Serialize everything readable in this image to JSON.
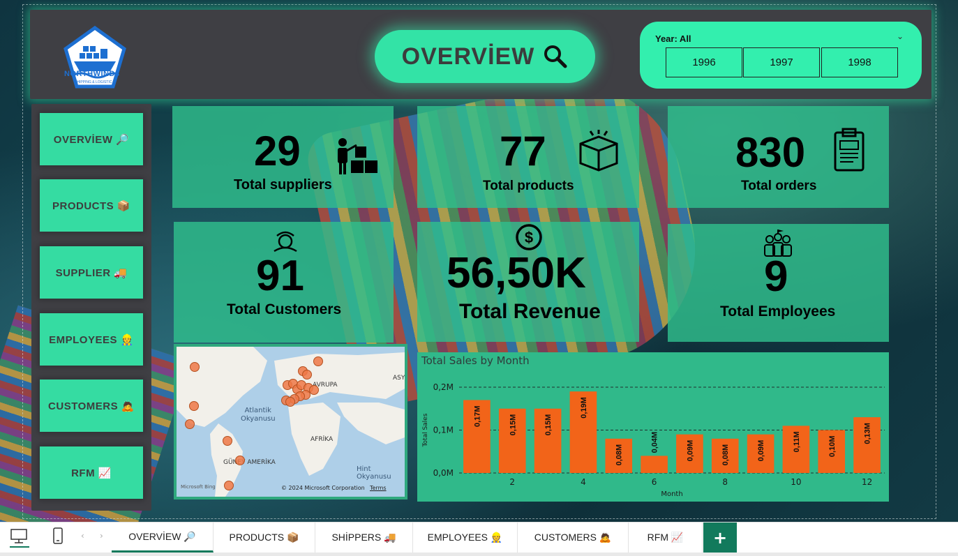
{
  "header": {
    "logo_text": "NORTHWIND",
    "logo_sub": "SHIPPING & LOGISTIC",
    "title": "OVERVİEW"
  },
  "year_filter": {
    "label": "Year: All",
    "options": [
      "1996",
      "1997",
      "1998"
    ]
  },
  "nav": {
    "items": [
      {
        "label": "OVERVİEW 🔎"
      },
      {
        "label": "PRODUCTS 📦"
      },
      {
        "label": "SUPPLIER 🚚"
      },
      {
        "label": "EMPLOYEES 👷"
      },
      {
        "label": "CUSTOMERS 🙇"
      },
      {
        "label": "RFM 📈"
      }
    ]
  },
  "kpis": {
    "suppliers": {
      "value": "29",
      "label": "Total suppliers"
    },
    "products": {
      "value": "77",
      "label": "Total products"
    },
    "orders": {
      "value": "830",
      "label": "Total orders"
    },
    "customers": {
      "value": "91",
      "label": "Total Customers"
    },
    "revenue": {
      "value": "56,50K",
      "label": "Total Revenue"
    },
    "employees": {
      "value": "9",
      "label": "Total Employees"
    }
  },
  "map": {
    "labels": {
      "atlantic": "Atlantik\nOkyanusu",
      "europe": "AVRUPA",
      "asia": "ASY",
      "africa": "AFRİKA",
      "south_america": "GÜNEY AMERİKA",
      "indian": "Hint Okyanusu"
    },
    "bing": "Microsoft Bing",
    "copyright": "© 2024 Microsoft Corporation",
    "terms": "Terms"
  },
  "chart_data": {
    "type": "bar",
    "title": "Total Sales by Month",
    "xlabel": "Month",
    "ylabel": "Total Sales",
    "categories": [
      1,
      2,
      3,
      4,
      5,
      6,
      7,
      8,
      9,
      10,
      11,
      12
    ],
    "values": [
      0.17,
      0.15,
      0.15,
      0.19,
      0.08,
      0.04,
      0.09,
      0.08,
      0.09,
      0.11,
      0.1,
      0.13
    ],
    "data_labels": [
      "0,17M",
      "0,15M",
      "0,15M",
      "0,19M",
      "0,08M",
      "0,04M",
      "0,09M",
      "0,08M",
      "0,09M",
      "0,11M",
      "0,10M",
      "0,13M"
    ],
    "x_tick_labels": [
      "2",
      "4",
      "6",
      "8",
      "10",
      "12"
    ],
    "y_tick_labels": [
      "0,0M",
      "0,1M",
      "0,2M"
    ],
    "ylim": [
      0,
      0.2
    ],
    "bar_color": "#f26419",
    "grid": true
  },
  "tabs": {
    "items": [
      {
        "label": "OVERVİEW 🔎",
        "active": true
      },
      {
        "label": "PRODUCTS 📦"
      },
      {
        "label": "SHİPPERS 🚚"
      },
      {
        "label": "EMPLOYEES 👷"
      },
      {
        "label": "CUSTOMERS 🙇"
      },
      {
        "label": "RFM 📈"
      }
    ],
    "add": "+"
  },
  "colors": {
    "accent": "#33e3a6",
    "card": "#30b98a",
    "panel": "#3f3f44",
    "tab_active": "#127a5c"
  }
}
